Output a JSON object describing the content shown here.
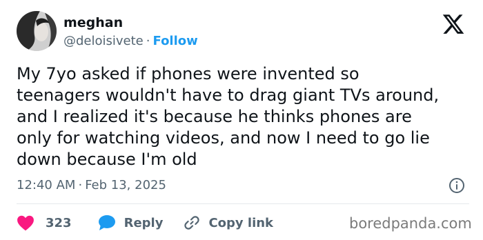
{
  "author": {
    "name": "meghan",
    "handle": "@deloisivete",
    "separator": "·",
    "follow_label": "Follow",
    "avatar_icon": "profile-photo"
  },
  "logo_icon": "x-logo",
  "tweet": {
    "lines": [
      "My 7yo asked if phones were invented so",
      "teenagers wouldn't have to drag giant TVs around,",
      "and I realized it's because he thinks phones are",
      "only for watching videos, and now I need to go lie",
      "down because I'm old"
    ]
  },
  "meta": {
    "time": "12:40 AM",
    "separator": "·",
    "date": "Feb 13, 2025",
    "info_icon": "info-icon"
  },
  "actions": {
    "like_count": "323",
    "reply_label": "Reply",
    "copy_label": "Copy link"
  },
  "watermark": "boredpanda.com",
  "colors": {
    "text": "#0f1419",
    "secondary": "#536471",
    "accent": "#1d9bf0",
    "like": "#f91880",
    "divider": "#e4e8eb"
  }
}
